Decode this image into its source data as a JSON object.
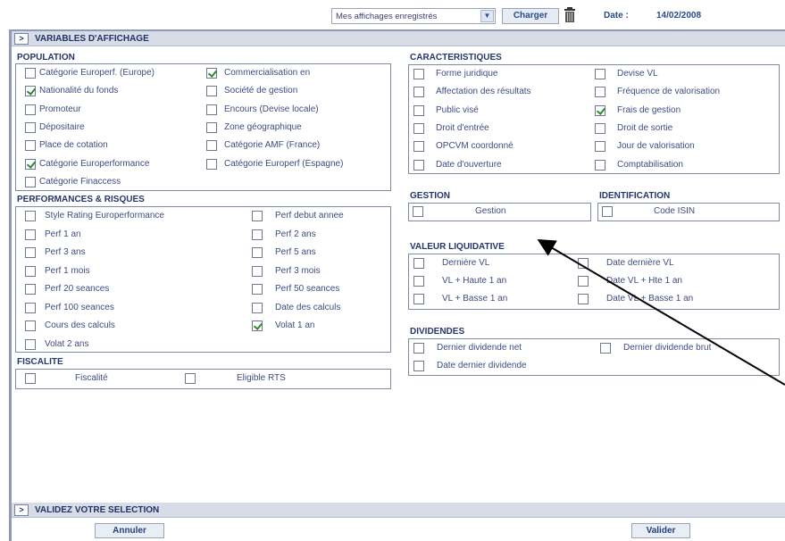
{
  "topbar": {
    "saved_views_value": "Mes affichages enregistrés",
    "load_label": "Charger",
    "date_label": "Date :",
    "date_value": "14/02/2008"
  },
  "sections": {
    "display_vars": "VARIABLES D'AFFICHAGE",
    "validate": "VALIDEZ VOTRE SELECTION"
  },
  "population": {
    "title": "POPULATION",
    "left": [
      {
        "label": "Catégorie Europerf. (Europe)",
        "checked": false
      },
      {
        "label": "Nationalité du fonds",
        "checked": true
      },
      {
        "label": "Promoteur",
        "checked": false
      },
      {
        "label": "Dépositaire",
        "checked": false
      },
      {
        "label": "Place de cotation",
        "checked": false
      },
      {
        "label": "Catégorie Europerformance",
        "checked": true
      },
      {
        "label": "Catégorie Finaccess",
        "checked": false
      }
    ],
    "right": [
      {
        "label": "Commercialisation en",
        "checked": true
      },
      {
        "label": "Société de gestion",
        "checked": false
      },
      {
        "label": "Encours (Devise locale)",
        "checked": false
      },
      {
        "label": "Zone géographique",
        "checked": false
      },
      {
        "label": "Catégorie AMF (France)",
        "checked": false
      },
      {
        "label": "Catégorie Europerf (Espagne)",
        "checked": false
      }
    ]
  },
  "perf": {
    "title": "PERFORMANCES & RISQUES",
    "left": [
      {
        "label": "Style Rating Europerformance",
        "checked": false
      },
      {
        "label": "Perf 1 an",
        "checked": false
      },
      {
        "label": "Perf 3 ans",
        "checked": false
      },
      {
        "label": "Perf 1 mois",
        "checked": false
      },
      {
        "label": "Perf 20 seances",
        "checked": false
      },
      {
        "label": "Perf 100 seances",
        "checked": false
      },
      {
        "label": "Cours des calculs",
        "checked": false
      },
      {
        "label": "Volat 2 ans",
        "checked": false
      }
    ],
    "right": [
      {
        "label": "Perf debut annee",
        "checked": false
      },
      {
        "label": "Perf 2 ans",
        "checked": false
      },
      {
        "label": "Perf 5 ans",
        "checked": false
      },
      {
        "label": "Perf 3 mois",
        "checked": false
      },
      {
        "label": "Perf 50 seances",
        "checked": false
      },
      {
        "label": "Date des calculs",
        "checked": false
      },
      {
        "label": "Volat 1 an",
        "checked": true
      }
    ]
  },
  "fiscalite": {
    "title": "FISCALITE",
    "items": [
      {
        "label": "Fiscalité",
        "checked": false
      },
      {
        "label": "Eligible RTS",
        "checked": false
      }
    ]
  },
  "caract": {
    "title": "CARACTERISTIQUES",
    "left": [
      {
        "label": "Forme juridique",
        "checked": false
      },
      {
        "label": "Affectation des résultats",
        "checked": false
      },
      {
        "label": "Public visé",
        "checked": false
      },
      {
        "label": "Droit d'entrée",
        "checked": false
      },
      {
        "label": "OPCVM coordonné",
        "checked": false
      },
      {
        "label": "Date d'ouverture",
        "checked": false
      }
    ],
    "right": [
      {
        "label": "Devise VL",
        "checked": false
      },
      {
        "label": "Fréquence de valorisation",
        "checked": false
      },
      {
        "label": "Frais de gestion",
        "checked": true
      },
      {
        "label": "Droit de sortie",
        "checked": false
      },
      {
        "label": "Jour de valorisation",
        "checked": false
      },
      {
        "label": "Comptabilisation",
        "checked": false
      }
    ]
  },
  "gestion": {
    "title": "GESTION",
    "item": {
      "label": "Gestion",
      "checked": false
    }
  },
  "identification": {
    "title": "IDENTIFICATION",
    "item": {
      "label": "Code ISIN",
      "checked": false
    }
  },
  "vl": {
    "title": "VALEUR LIQUIDATIVE",
    "left": [
      {
        "label": "Dernière VL",
        "checked": false
      },
      {
        "label": "VL + Haute 1 an",
        "checked": false
      },
      {
        "label": "VL + Basse 1 an",
        "checked": false
      }
    ],
    "right": [
      {
        "label": "Date dernière VL",
        "checked": false
      },
      {
        "label": "Date VL + Hte 1 an",
        "checked": false
      },
      {
        "label": "Date VL + Basse 1 an",
        "checked": false
      }
    ]
  },
  "dividendes": {
    "title": "DIVIDENDES",
    "left": [
      {
        "label": "Dernier dividende net",
        "checked": false
      },
      {
        "label": "Date dernier dividende",
        "checked": false
      }
    ],
    "right": [
      {
        "label": "Dernier dividende brut",
        "checked": false
      }
    ]
  },
  "footer": {
    "cancel_label": "Annuler",
    "validate_label": "Valider"
  }
}
